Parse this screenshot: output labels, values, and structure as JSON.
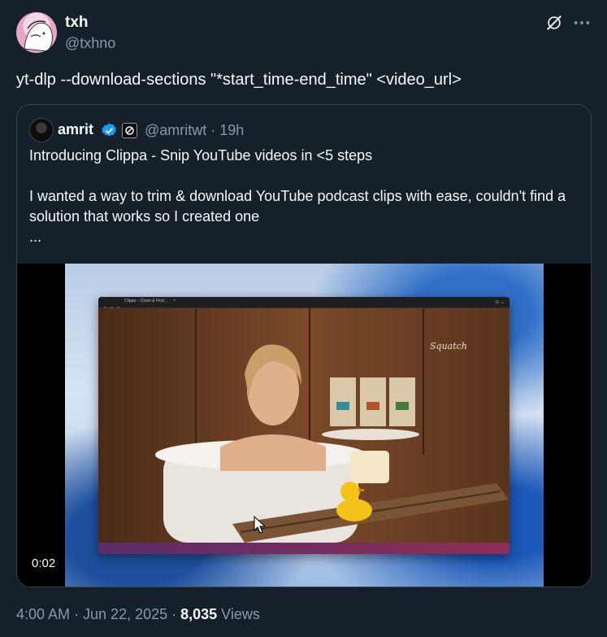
{
  "author": {
    "name": "txh",
    "handle": "@txhno",
    "avatar_icon": "anime-avatar-icon"
  },
  "actions": {
    "grok_icon": "grok-icon",
    "more_icon": "more-icon"
  },
  "tweet": {
    "text": "yt-dlp --download-sections \"*start_time-end_time\" <video_url>"
  },
  "quote": {
    "name": "amrit",
    "handle_time": "@amritwt · 19h",
    "verified_icon": "verified-badge-icon",
    "org_icon": "org-badge-icon",
    "line1": "Introducing Clippa - Snip YouTube videos in <5 steps",
    "line2": "I wanted a way to trim & download YouTube podcast clips with ease, couldn't find a solution that works so I created one",
    "line3": "...",
    "video": {
      "duration": "0:02",
      "app_tab": "Clippa – Clean & Find…",
      "brand_label": "Squatch"
    }
  },
  "meta": {
    "time": "4:00 AM · Jun 22, 2025 · ",
    "views_count": "8,035",
    "views_label": " Views"
  },
  "colors": {
    "background": "#15202b",
    "text": "#f7f9f9",
    "muted": "#8b98a5",
    "border": "#38444d",
    "verified": "#1d9bf0"
  }
}
